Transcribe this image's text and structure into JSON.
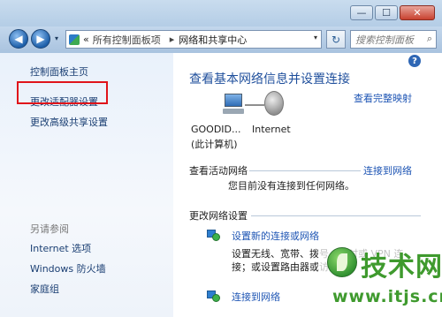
{
  "titlebar": {
    "minimize_glyph": "—",
    "maximize_glyph": "☐",
    "close_glyph": "✕"
  },
  "nav": {
    "back_glyph": "◀",
    "forward_glyph": "▶",
    "dropdown_glyph": "▾",
    "breadcrumb": {
      "prefix": "«",
      "items": [
        "所有控制面板项",
        "网络和共享中心"
      ],
      "separator": "▸",
      "dropdown_glyph": "▾"
    },
    "refresh_glyph": "↻",
    "search_placeholder": "搜索控制面板",
    "search_icon_glyph": "⌕"
  },
  "sidebar": {
    "items": [
      {
        "label": "控制面板主页"
      },
      {
        "label": "更改适配器设置",
        "highlighted": true
      },
      {
        "label": "更改高级共享设置"
      }
    ],
    "see_also_label": "另请参阅",
    "see_also_items": [
      {
        "label": "Internet 选项"
      },
      {
        "label": "Windows 防火墙"
      },
      {
        "label": "家庭组"
      }
    ]
  },
  "main": {
    "help_glyph": "?",
    "title": "查看基本网络信息并设置连接",
    "view_full_map": "查看完整映射",
    "computer_name": "GOODID...",
    "computer_sublabel": "(此计算机)",
    "internet_label": "Internet",
    "active_networks": {
      "heading": "查看活动网络",
      "connect_link": "连接到网络",
      "status": "您目前没有连接到任何网络。"
    },
    "change_settings": {
      "heading": "更改网络设置",
      "tasks": [
        {
          "title": "设置新的连接或网络",
          "description": "设置无线、宽带、拨号、临时或 VPN 连接；或设置路由器或访问点。"
        },
        {
          "title": "连接到网络",
          "description": ""
        }
      ]
    }
  },
  "watermark": {
    "brand_text": "技术网",
    "url": "www.itjs.cn"
  },
  "colors": {
    "link": "#1e55b4",
    "highlight_box": "#e0141a",
    "title": "#1f4f9c",
    "watermark": "#3f9a2e"
  }
}
